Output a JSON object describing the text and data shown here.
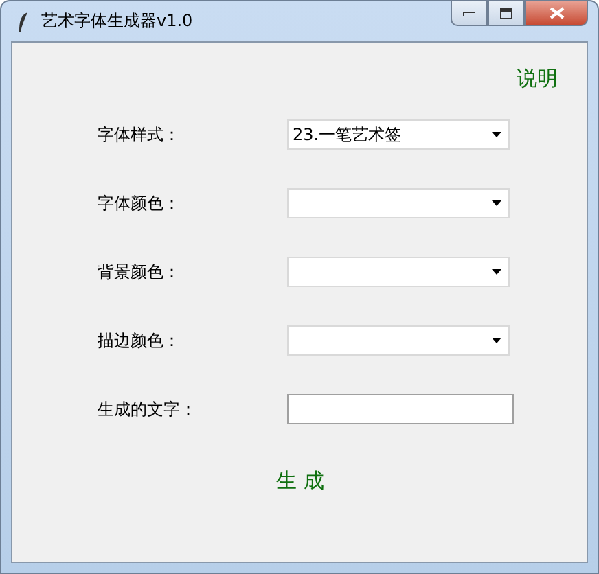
{
  "window": {
    "title": "艺术字体生成器v1.0"
  },
  "help_link": "说明",
  "fields": [
    {
      "label": "字体样式：",
      "kind": "combo",
      "value": "23.一笔艺术签"
    },
    {
      "label": "字体颜色：",
      "kind": "combo"
    },
    {
      "label": "背景颜色：",
      "kind": "combo"
    },
    {
      "label": "描边颜色：",
      "kind": "combo"
    },
    {
      "label": "生成的文字：",
      "kind": "entry"
    }
  ],
  "generate_button": "生 成"
}
